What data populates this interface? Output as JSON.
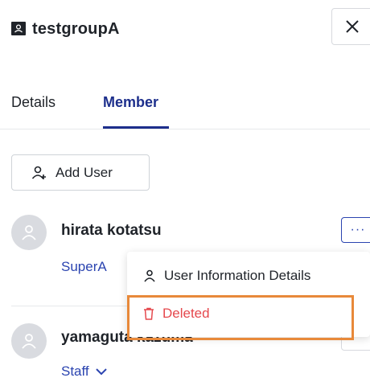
{
  "header": {
    "title": "testgroupA",
    "group_icon": "group-folder-icon",
    "close_icon": "close-icon"
  },
  "tabs": [
    {
      "label": "Details",
      "active": false
    },
    {
      "label": "Member",
      "active": true
    }
  ],
  "add_user": {
    "label": "Add User",
    "icon": "add-user-icon"
  },
  "members": [
    {
      "name": "hirata kotatsu",
      "role": "SuperA",
      "role_full_hidden": false
    },
    {
      "name": "yamaguta kazuma",
      "role": "Staff"
    }
  ],
  "row_menu": {
    "more_label": "···",
    "items": [
      {
        "label": "User Information Details",
        "icon": "user-icon"
      },
      {
        "label": "Deleted",
        "icon": "trash-icon"
      }
    ]
  },
  "colors": {
    "accent": "#1d2f8c",
    "link": "#2b44b0",
    "danger": "#e5484d",
    "highlight": "#e8893a"
  }
}
